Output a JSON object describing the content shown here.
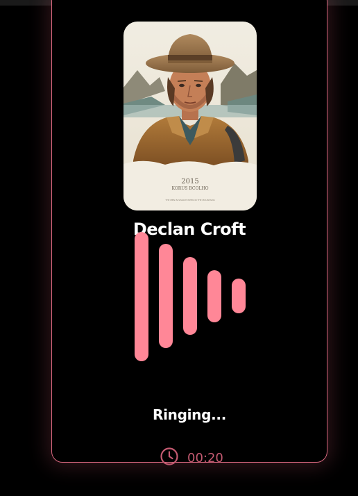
{
  "caller": {
    "name": "Declan Croft",
    "poster": {
      "year": "2015",
      "subtitle": "KORUS BCOLHO",
      "fine_print": "THE MEN IN SEARCH WHEN IN THE MOUNTAINS"
    }
  },
  "call": {
    "status": "Ringing...",
    "timer": "00:20"
  },
  "icons": {
    "timer": "clock-icon"
  },
  "colors": {
    "accent": "#ff8797",
    "border": "#d8687f",
    "timer_text": "#c45a71",
    "background": "#000000"
  }
}
